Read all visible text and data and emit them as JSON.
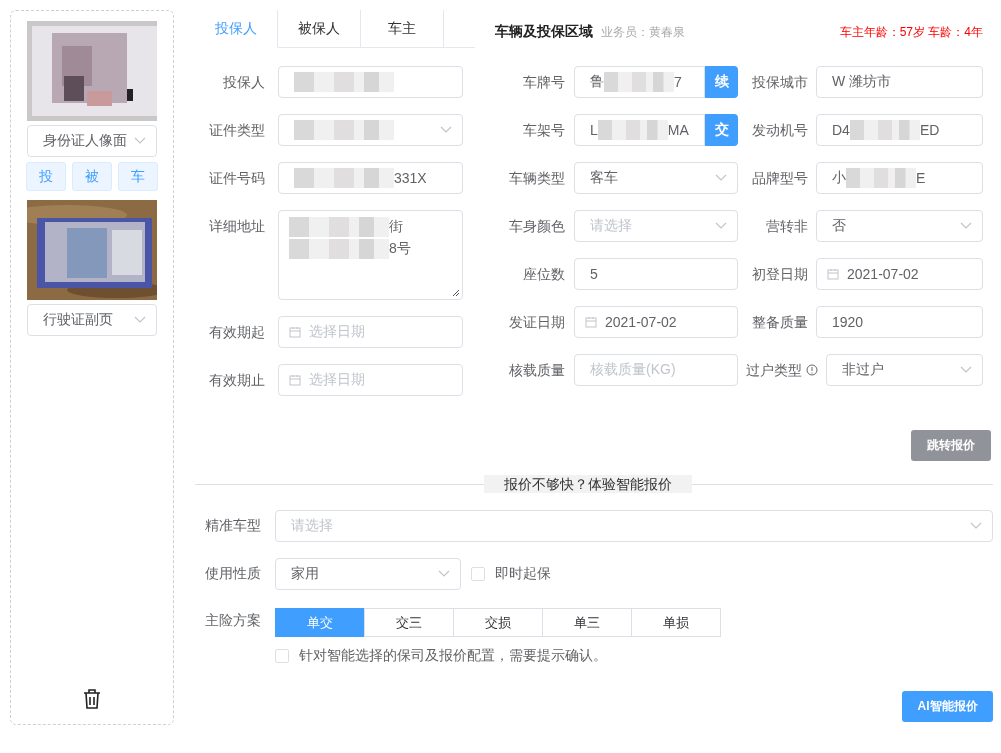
{
  "left_panel": {
    "documents": [
      {
        "kind": "picture",
        "type_label": "身份证人像面"
      },
      {
        "kind": "picture",
        "type_label": "行驶证副页"
      }
    ],
    "role_buttons": [
      "投",
      "被",
      "车"
    ]
  },
  "person_tabs": [
    {
      "label": "投保人",
      "selected": true
    },
    {
      "label": "被保人",
      "selected": false
    },
    {
      "label": "车主",
      "selected": false
    }
  ],
  "person_fields": [
    {
      "label": "投保人",
      "kind": "text",
      "redacted": true
    },
    {
      "label": "证件类型",
      "kind": "select",
      "redacted": true
    },
    {
      "label": "证件号码",
      "kind": "text",
      "redacted": true,
      "value": "331X"
    },
    {
      "label": "详细地址",
      "kind": "textarea",
      "redacted": true,
      "lines": [
        "街",
        "8号"
      ]
    },
    {
      "label": "有效期起",
      "kind": "date",
      "placeholder": "选择日期"
    },
    {
      "label": "有效期止",
      "kind": "date",
      "placeholder": "选择日期"
    }
  ],
  "vehicle_section": {
    "title": "车辆及投保区域",
    "salesperson": "业务员：黄春泉",
    "age_note": "车主年龄：57岁 车龄：4年"
  },
  "vehicle_fields": [
    {
      "label": "车牌号",
      "kind": "addon",
      "prefix": "鲁",
      "value": "7",
      "redacted": true,
      "addon": "续"
    },
    {
      "label": "投保城市",
      "kind": "text",
      "value": "W 潍坊市"
    },
    {
      "label": "车架号",
      "kind": "addon",
      "prefix": "L",
      "value": "MA",
      "redacted": true,
      "addon": "交"
    },
    {
      "label": "发动机号",
      "kind": "text",
      "prefix": "D4",
      "value": "ED",
      "redacted": true
    },
    {
      "label": "车辆类型",
      "kind": "select",
      "value": "客车"
    },
    {
      "label": "品牌型号",
      "kind": "text",
      "prefix": "小",
      "value": "E",
      "redacted": true
    },
    {
      "label": "车身颜色",
      "kind": "select",
      "placeholder": "请选择"
    },
    {
      "label": "营转非",
      "kind": "select",
      "value": "否"
    },
    {
      "label": "座位数",
      "kind": "text",
      "value": "5"
    },
    {
      "label": "初登日期",
      "kind": "date",
      "value": "2021-07-02"
    },
    {
      "label": "发证日期",
      "kind": "date",
      "value": "2021-07-02"
    },
    {
      "label": "整备质量",
      "kind": "text",
      "value": "1920"
    },
    {
      "label": "核载质量",
      "kind": "text",
      "placeholder": "核载质量(KG)"
    },
    {
      "label": "过户类型",
      "kind": "select",
      "value": "非过户",
      "info": true
    }
  ],
  "jump_button": "跳转报价",
  "divider_text": "报价不够快？体验智能报价",
  "smart_form": {
    "precise_model": {
      "label": "精准车型",
      "placeholder": "请选择"
    },
    "usage": {
      "label": "使用性质",
      "value": "家用"
    },
    "instant_start": {
      "label": "即时起保",
      "checked": false
    },
    "plan": {
      "label": "主险方案",
      "options": [
        {
          "label": "单交",
          "selected": true
        },
        {
          "label": "交三",
          "selected": false
        },
        {
          "label": "交损",
          "selected": false
        },
        {
          "label": "单三",
          "selected": false
        },
        {
          "label": "单损",
          "selected": false
        }
      ]
    },
    "confirm": {
      "label": "针对智能选择的保司及报价配置，需要提示确认。",
      "checked": false
    }
  },
  "ai_button": "AI智能报价"
}
